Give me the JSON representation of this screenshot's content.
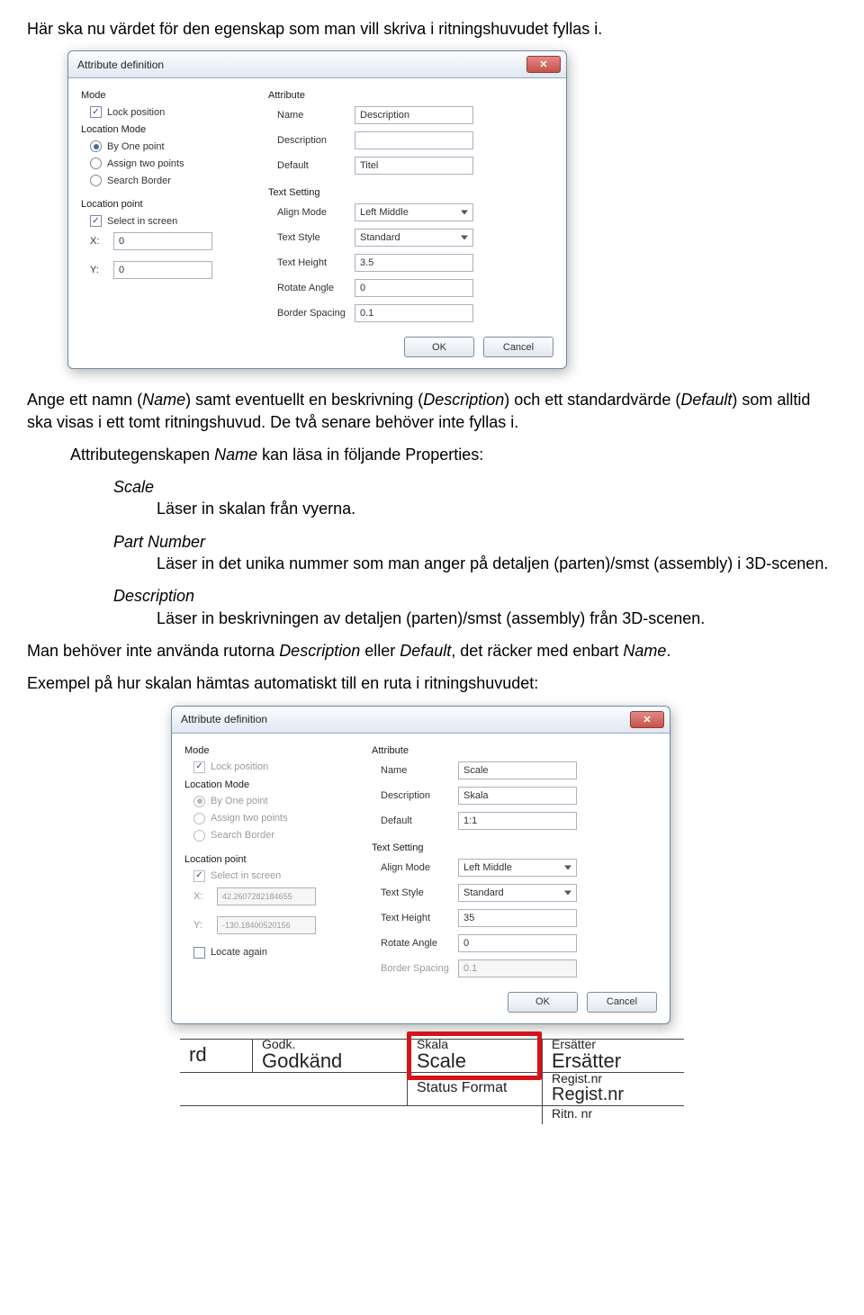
{
  "intro_text": "Här ska nu värdet för den egenskap som man vill skriva i ritningshuvudet fyllas i.",
  "dialog1": {
    "title": "Attribute definition",
    "mode_label": "Mode",
    "lock_position": "Lock position",
    "location_mode_label": "Location Mode",
    "by_one_point": "By One point",
    "assign_two_points": "Assign two points",
    "search_border": "Search Border",
    "location_point_label": "Location point",
    "select_in_screen": "Select in screen",
    "x_label": "X:",
    "y_label": "Y:",
    "x_value": "0",
    "y_value": "0",
    "attribute_label": "Attribute",
    "name_label": "Name",
    "name_value": "Description",
    "description_label": "Description",
    "description_value": "",
    "default_label": "Default",
    "default_value": "Titel",
    "text_setting_label": "Text Setting",
    "align_mode_label": "Align Mode",
    "align_mode_value": "Left Middle",
    "text_style_label": "Text Style",
    "text_style_value": "Standard",
    "text_height_label": "Text Height",
    "text_height_value": "3.5",
    "rotate_angle_label": "Rotate Angle",
    "rotate_angle_value": "0",
    "border_spacing_label": "Border Spacing",
    "border_spacing_value": "0.1",
    "ok": "OK",
    "cancel": "Cancel"
  },
  "para2a": "Ange ett namn (",
  "para2b": ") samt eventuellt en beskrivning (",
  "para2c": ") och ett standardvärde (",
  "para2d": ") som alltid ska visas i ett tomt ritningshuvud. De två senare behöver inte fyllas i.",
  "name_i": "Name",
  "desc_i": "Description",
  "default_i": "Default",
  "attr_intro_a": "Attributegenskapen ",
  "attr_intro_b": " kan läsa in följande Properties:",
  "scale_label": "Scale",
  "scale_text": "Läser in skalan från vyerna.",
  "partnum_label": "Part Number",
  "partnum_text": "Läser in det unika nummer som man anger på detaljen (parten)/smst (assembly) i 3D-scenen.",
  "desc_label": "Description",
  "desc_text": "Läser in beskrivningen av detaljen (parten)/smst (assembly) från 3D-scenen.",
  "para3a": "Man behöver inte använda rutorna ",
  "para3b": " eller ",
  "para3c": ", det räcker med enbart ",
  "para3d": ".",
  "para4": "Exempel på hur skalan hämtas automatiskt till en ruta i ritningshuvudet:",
  "dialog2": {
    "title": "Attribute definition",
    "lock_position": "Lock position",
    "by_one_point": "By One point",
    "assign_two_points": "Assign two points",
    "search_border": "Search Border",
    "select_in_screen": "Select in screen",
    "x_value": "42.2607282184655",
    "y_value": "-130.18400520156",
    "locate_again": "Locate again",
    "name_value": "Scale",
    "description_value": "Skala",
    "default_value": "1:1",
    "align_mode_value": "Left Middle",
    "text_style_value": "Standard",
    "text_height_value": "35",
    "rotate_angle_value": "0",
    "border_spacing_value": "0.1",
    "ok": "OK",
    "cancel": "Cancel"
  },
  "tb": {
    "rd": "rd",
    "godk_sm": "Godk.",
    "godk_bg": "Godkänd",
    "skala_sm": "Skala",
    "scale_bg": "Scale",
    "ers_sm": "Ersätter",
    "ers_bg": "Ersätter",
    "statusformat": "Status Format",
    "registnr_sm": "Regist.nr",
    "registnr_bg": "Regist.nr",
    "ritnnr": "Ritn. nr"
  }
}
